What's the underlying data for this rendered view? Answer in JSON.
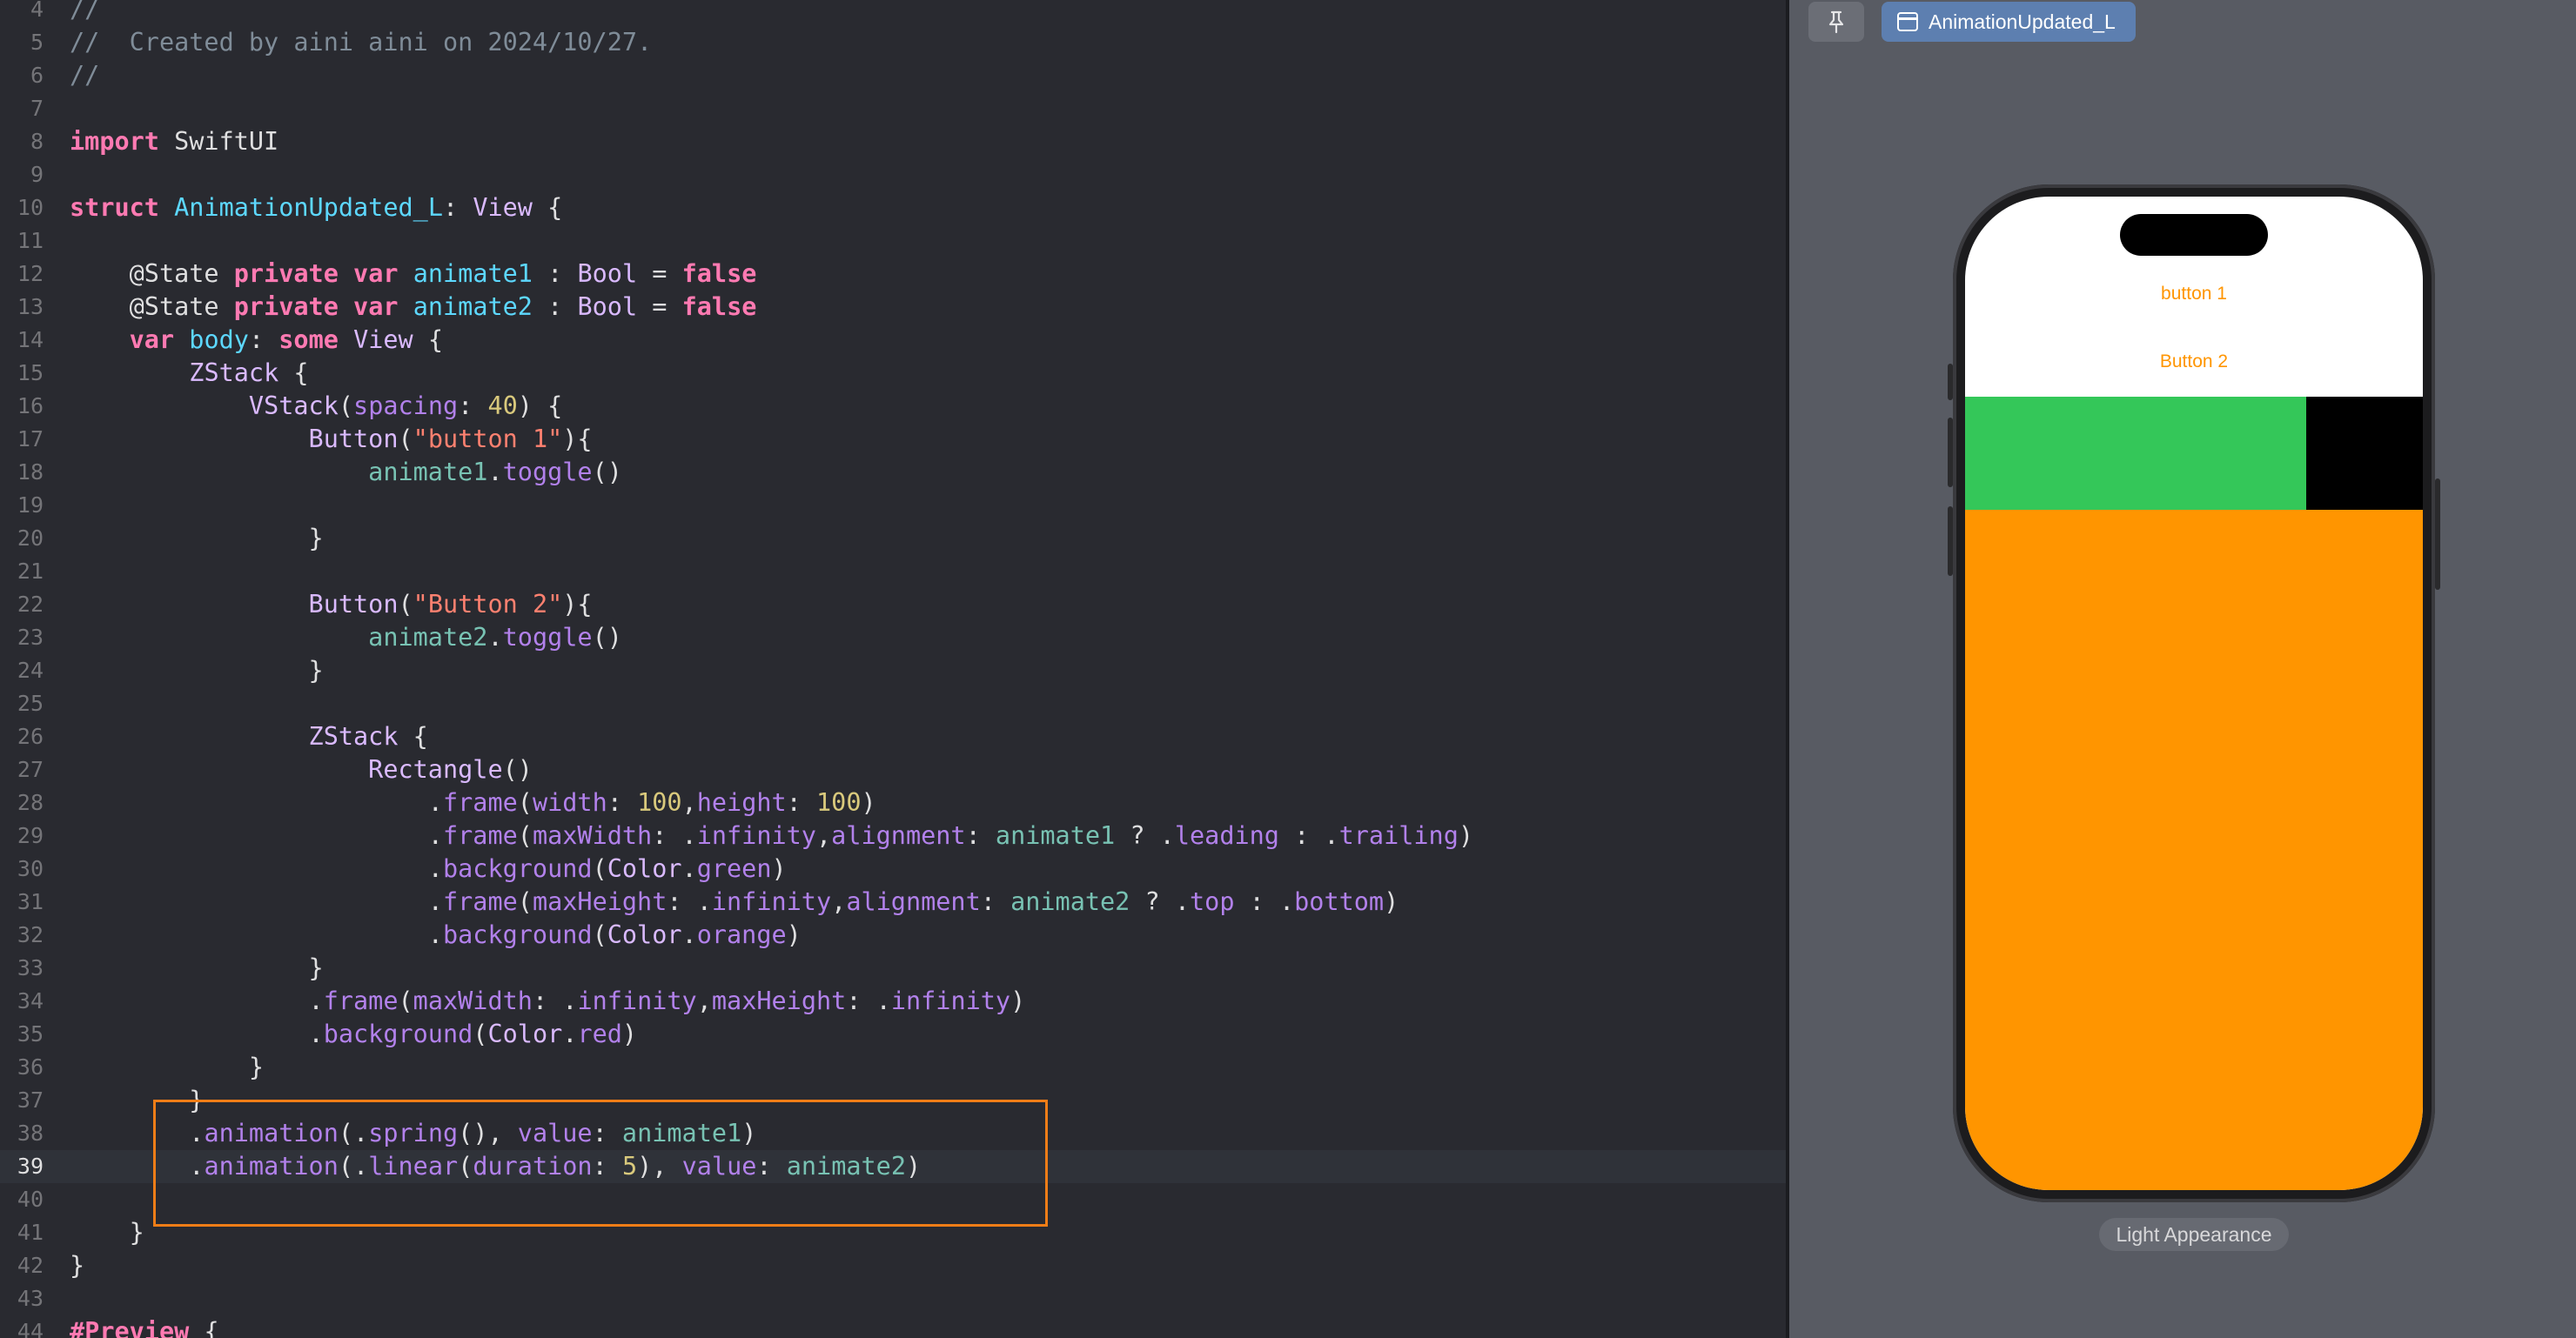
{
  "editor": {
    "lines": [
      {
        "n": "4",
        "tokens": [
          [
            "t-comment",
            "//"
          ]
        ]
      },
      {
        "n": "5",
        "tokens": [
          [
            "t-comment",
            "//  Created by aini aini on 2024/10/27."
          ]
        ]
      },
      {
        "n": "6",
        "tokens": [
          [
            "t-comment",
            "//"
          ]
        ]
      },
      {
        "n": "7",
        "tokens": []
      },
      {
        "n": "8",
        "tokens": [
          [
            "t-keyword",
            "import"
          ],
          [
            "",
            " SwiftUI"
          ]
        ]
      },
      {
        "n": "9",
        "tokens": []
      },
      {
        "n": "10",
        "tokens": [
          [
            "t-keyword",
            "struct"
          ],
          [
            "",
            " "
          ],
          [
            "t-decl",
            "AnimationUpdated_L"
          ],
          [
            "",
            ": "
          ],
          [
            "t-type",
            "View"
          ],
          [
            "",
            " {"
          ]
        ]
      },
      {
        "n": "11",
        "tokens": []
      },
      {
        "n": "12",
        "tokens": [
          [
            "",
            "    "
          ],
          [
            "t-attr",
            "@State"
          ],
          [
            "",
            " "
          ],
          [
            "t-keyword",
            "private"
          ],
          [
            "",
            " "
          ],
          [
            "t-keyword",
            "var"
          ],
          [
            "",
            " "
          ],
          [
            "t-decl",
            "animate1"
          ],
          [
            "",
            " : "
          ],
          [
            "t-type",
            "Bool"
          ],
          [
            "",
            " = "
          ],
          [
            "t-keyword",
            "false"
          ]
        ]
      },
      {
        "n": "13",
        "tokens": [
          [
            "",
            "    "
          ],
          [
            "t-attr",
            "@State"
          ],
          [
            "",
            " "
          ],
          [
            "t-keyword",
            "private"
          ],
          [
            "",
            " "
          ],
          [
            "t-keyword",
            "var"
          ],
          [
            "",
            " "
          ],
          [
            "t-decl",
            "animate2"
          ],
          [
            "",
            " : "
          ],
          [
            "t-type",
            "Bool"
          ],
          [
            "",
            " = "
          ],
          [
            "t-keyword",
            "false"
          ]
        ]
      },
      {
        "n": "14",
        "tokens": [
          [
            "",
            "    "
          ],
          [
            "t-keyword",
            "var"
          ],
          [
            "",
            " "
          ],
          [
            "t-decl",
            "body"
          ],
          [
            "",
            ": "
          ],
          [
            "t-keyword",
            "some"
          ],
          [
            "",
            " "
          ],
          [
            "t-type",
            "View"
          ],
          [
            "",
            " {"
          ]
        ]
      },
      {
        "n": "15",
        "tokens": [
          [
            "",
            "        "
          ],
          [
            "t-type",
            "ZStack"
          ],
          [
            "",
            " {"
          ]
        ]
      },
      {
        "n": "16",
        "tokens": [
          [
            "",
            "            "
          ],
          [
            "t-type",
            "VStack"
          ],
          [
            "",
            "("
          ],
          [
            "t-prop",
            "spacing"
          ],
          [
            "",
            ": "
          ],
          [
            "t-num",
            "40"
          ],
          [
            "",
            ") {"
          ]
        ]
      },
      {
        "n": "17",
        "tokens": [
          [
            "",
            "                "
          ],
          [
            "t-type",
            "Button"
          ],
          [
            "",
            "("
          ],
          [
            "t-str",
            "\"button 1\""
          ],
          [
            "",
            "){"
          ]
        ]
      },
      {
        "n": "18",
        "tokens": [
          [
            "",
            "                    "
          ],
          [
            "t-var",
            "animate1"
          ],
          [
            "",
            "."
          ],
          [
            "t-prop",
            "toggle"
          ],
          [
            "",
            "()"
          ]
        ]
      },
      {
        "n": "19",
        "tokens": []
      },
      {
        "n": "20",
        "tokens": [
          [
            "",
            "                }"
          ]
        ]
      },
      {
        "n": "21",
        "tokens": []
      },
      {
        "n": "22",
        "tokens": [
          [
            "",
            "                "
          ],
          [
            "t-type",
            "Button"
          ],
          [
            "",
            "("
          ],
          [
            "t-str",
            "\"Button 2\""
          ],
          [
            "",
            "){"
          ]
        ]
      },
      {
        "n": "23",
        "tokens": [
          [
            "",
            "                    "
          ],
          [
            "t-var",
            "animate2"
          ],
          [
            "",
            "."
          ],
          [
            "t-prop",
            "toggle"
          ],
          [
            "",
            "()"
          ]
        ]
      },
      {
        "n": "24",
        "tokens": [
          [
            "",
            "                }"
          ]
        ]
      },
      {
        "n": "25",
        "tokens": []
      },
      {
        "n": "26",
        "tokens": [
          [
            "",
            "                "
          ],
          [
            "t-type",
            "ZStack"
          ],
          [
            "",
            " {"
          ]
        ]
      },
      {
        "n": "27",
        "tokens": [
          [
            "",
            "                    "
          ],
          [
            "t-type",
            "Rectangle"
          ],
          [
            "",
            "()"
          ]
        ]
      },
      {
        "n": "28",
        "tokens": [
          [
            "",
            "                        ."
          ],
          [
            "t-prop",
            "frame"
          ],
          [
            "",
            "("
          ],
          [
            "t-prop",
            "width"
          ],
          [
            "",
            ": "
          ],
          [
            "t-num",
            "100"
          ],
          [
            "",
            ","
          ],
          [
            "t-prop",
            "height"
          ],
          [
            "",
            ": "
          ],
          [
            "t-num",
            "100"
          ],
          [
            "",
            ")"
          ]
        ]
      },
      {
        "n": "29",
        "tokens": [
          [
            "",
            "                        ."
          ],
          [
            "t-prop",
            "frame"
          ],
          [
            "",
            "("
          ],
          [
            "t-prop",
            "maxWidth"
          ],
          [
            "",
            ": ."
          ],
          [
            "t-prop",
            "infinity"
          ],
          [
            "",
            ","
          ],
          [
            "t-prop",
            "alignment"
          ],
          [
            "",
            ": "
          ],
          [
            "t-var",
            "animate1"
          ],
          [
            "",
            " ? ."
          ],
          [
            "t-prop",
            "leading"
          ],
          [
            "",
            " : ."
          ],
          [
            "t-prop",
            "trailing"
          ],
          [
            "",
            ")"
          ]
        ]
      },
      {
        "n": "30",
        "tokens": [
          [
            "",
            "                        ."
          ],
          [
            "t-prop",
            "background"
          ],
          [
            "",
            "("
          ],
          [
            "t-type",
            "Color"
          ],
          [
            "",
            "."
          ],
          [
            "t-prop",
            "green"
          ],
          [
            "",
            ")"
          ]
        ]
      },
      {
        "n": "31",
        "tokens": [
          [
            "",
            "                        ."
          ],
          [
            "t-prop",
            "frame"
          ],
          [
            "",
            "("
          ],
          [
            "t-prop",
            "maxHeight"
          ],
          [
            "",
            ": ."
          ],
          [
            "t-prop",
            "infinity"
          ],
          [
            "",
            ","
          ],
          [
            "t-prop",
            "alignment"
          ],
          [
            "",
            ": "
          ],
          [
            "t-var",
            "animate2"
          ],
          [
            "",
            " ? ."
          ],
          [
            "t-prop",
            "top"
          ],
          [
            "",
            " : ."
          ],
          [
            "t-prop",
            "bottom"
          ],
          [
            "",
            ")"
          ]
        ]
      },
      {
        "n": "32",
        "tokens": [
          [
            "",
            "                        ."
          ],
          [
            "t-prop",
            "background"
          ],
          [
            "",
            "("
          ],
          [
            "t-type",
            "Color"
          ],
          [
            "",
            "."
          ],
          [
            "t-prop",
            "orange"
          ],
          [
            "",
            ")"
          ]
        ]
      },
      {
        "n": "33",
        "tokens": [
          [
            "",
            "                }"
          ]
        ]
      },
      {
        "n": "34",
        "tokens": [
          [
            "",
            "                ."
          ],
          [
            "t-prop",
            "frame"
          ],
          [
            "",
            "("
          ],
          [
            "t-prop",
            "maxWidth"
          ],
          [
            "",
            ": ."
          ],
          [
            "t-prop",
            "infinity"
          ],
          [
            "",
            ","
          ],
          [
            "t-prop",
            "maxHeight"
          ],
          [
            "",
            ": ."
          ],
          [
            "t-prop",
            "infinity"
          ],
          [
            "",
            ")"
          ]
        ]
      },
      {
        "n": "35",
        "tokens": [
          [
            "",
            "                ."
          ],
          [
            "t-prop",
            "background"
          ],
          [
            "",
            "("
          ],
          [
            "t-type",
            "Color"
          ],
          [
            "",
            "."
          ],
          [
            "t-prop",
            "red"
          ],
          [
            "",
            ")"
          ]
        ]
      },
      {
        "n": "36",
        "tokens": [
          [
            "",
            "            }"
          ]
        ]
      },
      {
        "n": "37",
        "tokens": [
          [
            "",
            "        }"
          ]
        ]
      },
      {
        "n": "38",
        "tokens": [
          [
            "",
            "        ."
          ],
          [
            "t-prop",
            "animation"
          ],
          [
            "",
            "(."
          ],
          [
            "t-prop",
            "spring"
          ],
          [
            "",
            "(), "
          ],
          [
            "t-prop",
            "value"
          ],
          [
            "",
            ": "
          ],
          [
            "t-var",
            "animate1"
          ],
          [
            "",
            ")"
          ]
        ]
      },
      {
        "n": "39",
        "tokens": [
          [
            "",
            "        ."
          ],
          [
            "t-prop",
            "animation"
          ],
          [
            "",
            "(."
          ],
          [
            "t-prop",
            "linear"
          ],
          [
            "",
            "("
          ],
          [
            "t-prop",
            "duration"
          ],
          [
            "",
            ": "
          ],
          [
            "t-num",
            "5"
          ],
          [
            "",
            "), "
          ],
          [
            "t-prop",
            "value"
          ],
          [
            "",
            ": "
          ],
          [
            "t-var",
            "animate2"
          ],
          [
            "",
            ")"
          ]
        ],
        "current": true
      },
      {
        "n": "40",
        "tokens": []
      },
      {
        "n": "41",
        "tokens": [
          [
            "",
            "    }"
          ]
        ]
      },
      {
        "n": "42",
        "tokens": [
          [
            "",
            "}"
          ]
        ]
      },
      {
        "n": "43",
        "tokens": []
      },
      {
        "n": "44",
        "tokens": [
          [
            "t-keyword",
            "#Preview"
          ],
          [
            "",
            " {"
          ]
        ]
      }
    ],
    "highlight_color": "#ef7d17"
  },
  "canvas": {
    "pin_icon": "pin-icon",
    "tab_label": "AnimationUpdated_L",
    "tab_icon": "preview-window-icon",
    "appearance_label": "Light Appearance",
    "preview": {
      "button1_label": "button 1",
      "button2_label": "Button 2",
      "accent": "#ff9500",
      "green": "#34c759",
      "orange": "#ff9500"
    }
  }
}
